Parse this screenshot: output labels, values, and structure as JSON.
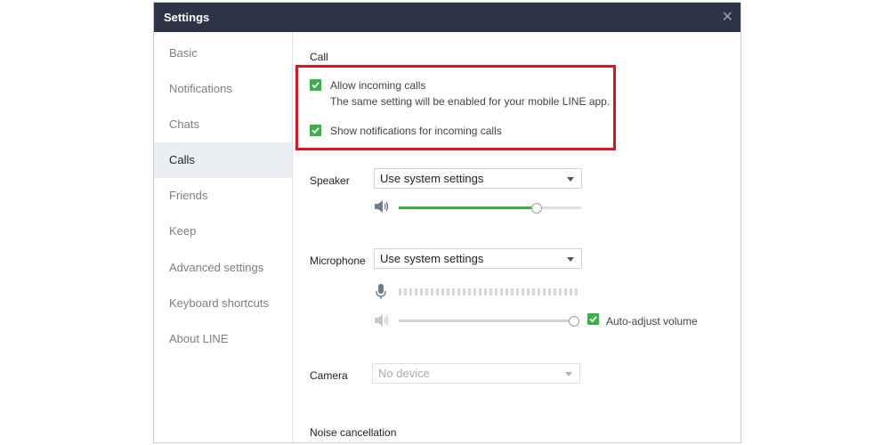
{
  "window": {
    "title": "Settings"
  },
  "sidebar": {
    "items": [
      {
        "label": "Basic"
      },
      {
        "label": "Notifications"
      },
      {
        "label": "Chats"
      },
      {
        "label": "Calls"
      },
      {
        "label": "Friends"
      },
      {
        "label": "Keep"
      },
      {
        "label": "Advanced settings"
      },
      {
        "label": "Keyboard shortcuts"
      },
      {
        "label": "About LINE"
      }
    ],
    "active": "Calls"
  },
  "call": {
    "section_title": "Call",
    "allow_incoming": {
      "label": "Allow incoming calls",
      "description": "The same setting will be enabled for your mobile LINE app.",
      "checked": true
    },
    "show_notifications": {
      "label": "Show notifications for incoming calls",
      "checked": true
    }
  },
  "speaker": {
    "label": "Speaker",
    "selected": "Use system settings",
    "volume_percent": 75
  },
  "microphone": {
    "label": "Microphone",
    "selected": "Use system settings",
    "volume_percent": 100,
    "auto_adjust": {
      "label": "Auto-adjust volume",
      "checked": true
    }
  },
  "camera": {
    "label": "Camera",
    "selected": "No device"
  },
  "noise": {
    "section_title": "Noise cancellation"
  },
  "colors": {
    "accent": "#3dae49",
    "titlebar": "#2d3446",
    "highlight": "#e0141e"
  },
  "icons": {
    "close": "close-icon",
    "speaker": "speaker-icon",
    "microphone": "microphone-icon"
  }
}
